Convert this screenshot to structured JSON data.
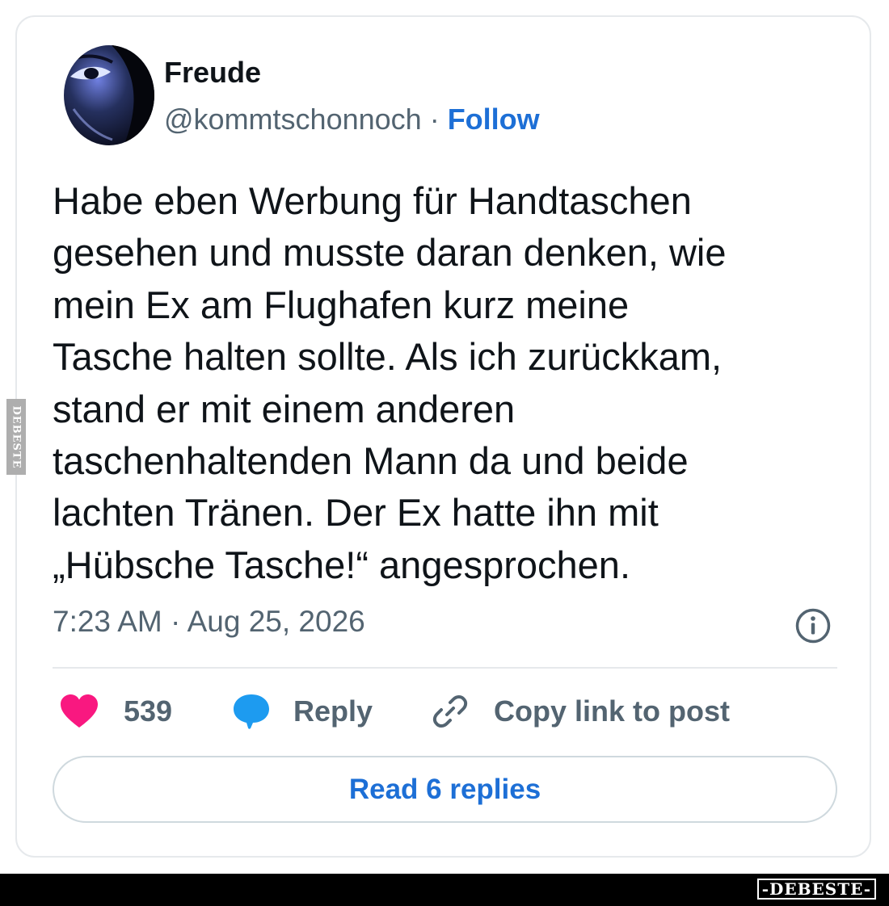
{
  "tweet": {
    "author_name": "Freude",
    "handle": "@kommtschonnoch",
    "separator": " · ",
    "follow_label": "Follow",
    "text": "Habe eben Werbung für Handtaschen\ngesehen und musste daran denken, wie\nmein Ex am Flughafen kurz meine\nTasche halten sollte. Als ich zurückkam,\nstand er mit einem anderen\ntaschenhaltenden Mann da und beide\nlachten Tränen. Der Ex hatte ihn mit\n„Hübsche Tasche!“ angesprochen.",
    "timestamp": "7:23 AM · Aug 25, 2026"
  },
  "actions": {
    "like_count": "539",
    "reply_label": "Reply",
    "copy_link_label": "Copy link to post"
  },
  "read_replies_label": "Read 6 replies",
  "watermark": {
    "side_text": "DEBESTE",
    "footer_text": "-DEBESTE-"
  },
  "icons": [
    "info-icon",
    "heart-icon",
    "reply-bubble-icon",
    "link-icon"
  ],
  "colors": {
    "link_blue": "#1d6fd6",
    "heart_pink": "#f91880",
    "reply_blue": "#1d9bf0",
    "text_gray": "#536471"
  }
}
